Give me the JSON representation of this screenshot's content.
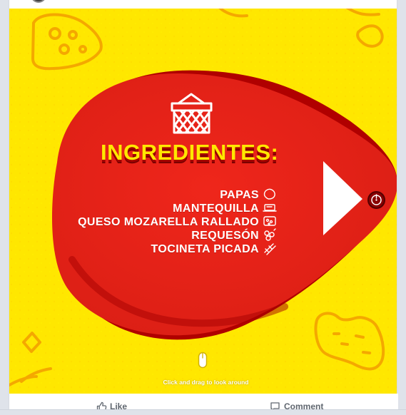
{
  "post": {
    "title": "INGREDIENTES:",
    "ingredients": [
      "PAPAS",
      "MANTEQUILLA",
      "QUESO MOZARELLA RALLADO",
      "REQUESÓN",
      "TOCINETA PICADA"
    ],
    "drag_hint": "Click and drag to look around"
  },
  "actions": {
    "like_label": "Like",
    "comment_label": "Comment"
  },
  "icons": {
    "basket": "basket-icon",
    "play": "play-icon",
    "gyro": "gyro-icon",
    "mouse": "mouse-icon",
    "like": "thumbs-up-icon",
    "comment": "comment-icon"
  },
  "colors": {
    "yellow_background": "#ffe700",
    "red_blob": "#e62319",
    "dark_red": "#9b0000",
    "title_yellow": "#ffe800",
    "ui_gray": "#606770"
  }
}
